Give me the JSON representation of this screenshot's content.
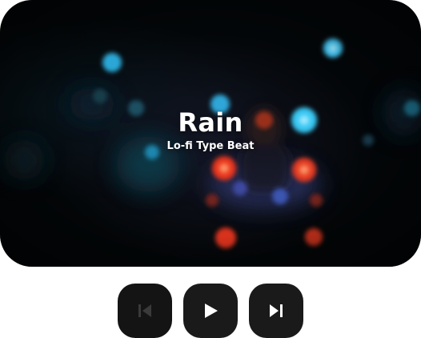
{
  "track": {
    "title": "Rain",
    "subtitle": "Lo-fi Type Beat"
  },
  "artwork": {
    "description_icon": "rainy-window-bokeh-artwork"
  },
  "controls": {
    "previous": {
      "icon": "skip-previous-icon",
      "enabled": false
    },
    "play": {
      "icon": "play-icon",
      "enabled": true
    },
    "next": {
      "icon": "skip-next-icon",
      "enabled": true
    }
  },
  "colors": {
    "background": "#ffffff",
    "card_background": "#030608",
    "control_background": "#1a1a1a",
    "icon_active": "#ffffff",
    "icon_disabled": "#3a3a3a",
    "text": "#ffffff"
  }
}
